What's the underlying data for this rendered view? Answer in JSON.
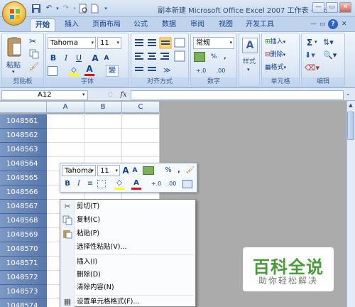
{
  "window": {
    "title": "副本新建 Microsoft Office Excel 2007 工作表 - Micros..."
  },
  "ribbon": {
    "tabs": [
      "开始",
      "插入",
      "页面布局",
      "公式",
      "数据",
      "审阅",
      "视图",
      "开发工具"
    ],
    "clipboard": {
      "paste": "粘贴",
      "label": "剪贴板"
    },
    "font": {
      "name": "Tahoma",
      "size": "11",
      "bold": "B",
      "italic": "I",
      "underline": "U",
      "grow": "A",
      "shrink": "A",
      "color_a": "A",
      "wen": "變",
      "label": "字体"
    },
    "alignment": {
      "label": "对齐方式"
    },
    "number": {
      "format": "常规",
      "percent": "%",
      "comma": ",",
      "inc": "+.0",
      "dec": ".00",
      "label": "数字"
    },
    "styles": {
      "label": "样式"
    },
    "cells": {
      "insert": "插入",
      "delete": "删除",
      "format": "格式",
      "label": "单元格"
    },
    "editing": {
      "sum": "Σ",
      "label": "编辑"
    }
  },
  "formula_bar": {
    "namebox": "A12",
    "fx": "fx"
  },
  "sheet": {
    "columns": [
      "A",
      "B",
      "C"
    ],
    "rows": [
      "1048561",
      "1048562",
      "1048563",
      "1048564",
      "1048565",
      "1048566",
      "1048567",
      "1048568",
      "1048569",
      "1048570",
      "1048571",
      "1048572",
      "1048573",
      "1048574"
    ]
  },
  "mini_toolbar": {
    "font": "Tahoma",
    "size": "11",
    "percent": "%",
    "comma": ",",
    "inc": "+.0",
    "dec": ".00"
  },
  "context_menu": {
    "items": [
      "剪切(T)",
      "复制(C)",
      "粘贴(P)",
      "选择性粘贴(V)...",
      "插入(I)",
      "删除(D)",
      "清除内容(N)",
      "设置单元格格式(F)..."
    ]
  },
  "watermark": {
    "title": "百科全说",
    "subtitle": "助你轻松解决"
  },
  "colors": {
    "row_header_selected": "#6480b3",
    "ribbon_bg": "#d7e4f4",
    "watermark_green": "#4a9a3c"
  }
}
